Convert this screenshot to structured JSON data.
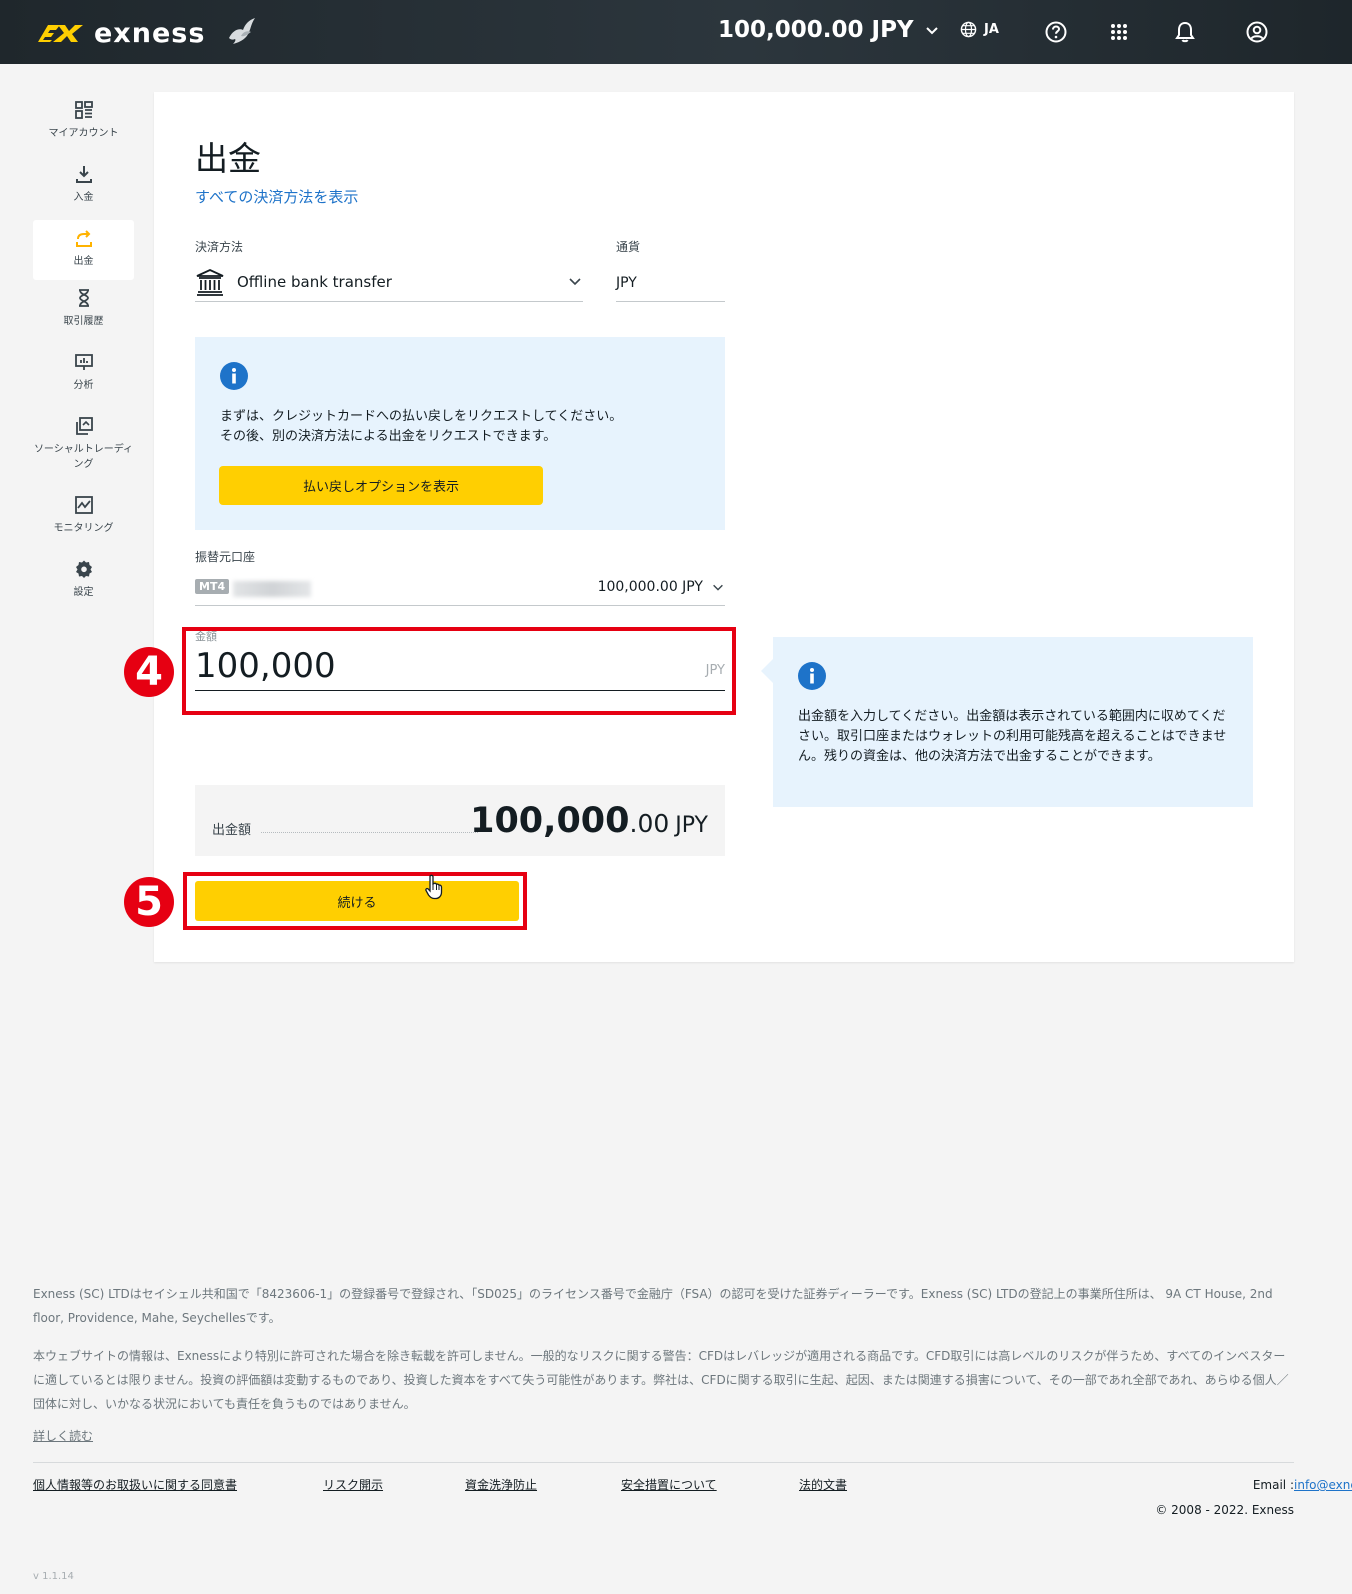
{
  "header": {
    "brand": "exness",
    "balance": "100,000.00 JPY",
    "language": "JA"
  },
  "sidebar": {
    "items": [
      {
        "label": "マイアカウント",
        "icon": "dashboard-icon"
      },
      {
        "label": "入金",
        "icon": "download-icon"
      },
      {
        "label": "出金",
        "icon": "upload-icon"
      },
      {
        "label": "取引履歴",
        "icon": "hourglass-icon"
      },
      {
        "label": "分析",
        "icon": "analytics-icon"
      },
      {
        "label": "ソーシャルトレーディング",
        "icon": "copy-icon"
      },
      {
        "label": "モニタリング",
        "icon": "chart-icon"
      },
      {
        "label": "設定",
        "icon": "gear-icon"
      }
    ],
    "active_index": 2
  },
  "main": {
    "title": "出金",
    "all_methods_link": "すべての決済方法を表示",
    "method_label": "決済方法",
    "method_value": "Offline bank transfer",
    "currency_label": "通貨",
    "currency_value": "JPY",
    "notice": {
      "line1": "まずは、クレジットカードへの払い戻しをリクエストしてください。",
      "line2": "その後、別の決済方法による出金をリクエストできます。",
      "button": "払い戻しオプションを表示"
    },
    "from_account_label": "振替元口座",
    "from_account_badge": "MT4",
    "from_account_balance": "100,000.00 JPY",
    "amount_label": "金額",
    "amount_value": "100,000",
    "amount_unit": "JPY",
    "amount_hint": "出金額を入力してください。出金額は表示されている範囲内に収めてください。取引口座またはウォレットの利用可能残高を超えることはできません。残りの資金は、他の決済方法で出金することができます。",
    "summary_label": "出金額",
    "summary_int": "100,000",
    "summary_dec": ".00",
    "summary_currency": "JPY",
    "continue_button": "続ける"
  },
  "annotations": {
    "step4": "4",
    "step5": "5",
    "highlight_color": "#e60012"
  },
  "footer": {
    "para1": "Exness (SC) LTDはセイシェル共和国で「8423606-1」の登録番号で登録され、「SD025」のライセンス番号で金融庁（FSA）の認可を受けた証券ディーラーです。Exness (SC) LTDの登記上の事業所住所は、 9A CT House, 2nd floor, Providence, Mahe, Seychellesです。",
    "para2": "本ウェブサイトの情報は、Exnessにより特別に許可された場合を除き転載を許可しません。一般的なリスクに関する警告：CFDはレバレッジが適用される商品です。CFD取引には高レベルのリスクが伴うため、すべてのインベスターに適しているとは限りません。投資の評価額は変動するものであり、投資した資本をすべて失う可能性があります。弊社は、CFDに関する取引に生起、起因、または関連する損害について、その一部であれ全部であれ、あらゆる個人／団体に対し、いかなる状況においても責任を負うものではありません。",
    "read_more": "詳しく読む",
    "links": [
      "個人情報等のお取扱いに関する同意書",
      "リスク開示",
      "資金洗浄防止",
      "安全措置について",
      "法的文書"
    ],
    "email_label": "Email : ",
    "email": "info@exness.com",
    "copyright": "© 2008 - 2022. Exness",
    "version": "v 1.1.14"
  },
  "colors": {
    "accent_yellow": "#ffcf01",
    "link_blue": "#1e73c9",
    "info_bg": "#e7f3fd",
    "topbar": "#1f272c"
  }
}
